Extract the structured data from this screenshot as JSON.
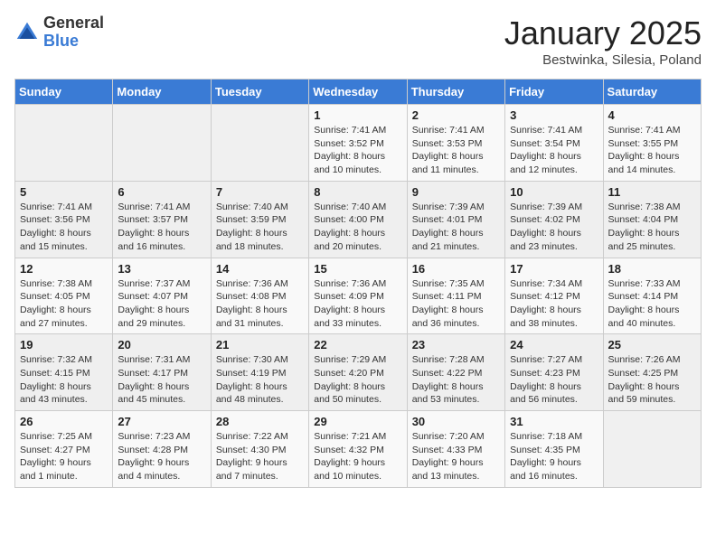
{
  "header": {
    "logo_general": "General",
    "logo_blue": "Blue",
    "month_title": "January 2025",
    "location": "Bestwinka, Silesia, Poland"
  },
  "weekdays": [
    "Sunday",
    "Monday",
    "Tuesday",
    "Wednesday",
    "Thursday",
    "Friday",
    "Saturday"
  ],
  "weeks": [
    [
      {
        "day": "",
        "info": ""
      },
      {
        "day": "",
        "info": ""
      },
      {
        "day": "",
        "info": ""
      },
      {
        "day": "1",
        "info": "Sunrise: 7:41 AM\nSunset: 3:52 PM\nDaylight: 8 hours and 10 minutes."
      },
      {
        "day": "2",
        "info": "Sunrise: 7:41 AM\nSunset: 3:53 PM\nDaylight: 8 hours and 11 minutes."
      },
      {
        "day": "3",
        "info": "Sunrise: 7:41 AM\nSunset: 3:54 PM\nDaylight: 8 hours and 12 minutes."
      },
      {
        "day": "4",
        "info": "Sunrise: 7:41 AM\nSunset: 3:55 PM\nDaylight: 8 hours and 14 minutes."
      }
    ],
    [
      {
        "day": "5",
        "info": "Sunrise: 7:41 AM\nSunset: 3:56 PM\nDaylight: 8 hours and 15 minutes."
      },
      {
        "day": "6",
        "info": "Sunrise: 7:41 AM\nSunset: 3:57 PM\nDaylight: 8 hours and 16 minutes."
      },
      {
        "day": "7",
        "info": "Sunrise: 7:40 AM\nSunset: 3:59 PM\nDaylight: 8 hours and 18 minutes."
      },
      {
        "day": "8",
        "info": "Sunrise: 7:40 AM\nSunset: 4:00 PM\nDaylight: 8 hours and 20 minutes."
      },
      {
        "day": "9",
        "info": "Sunrise: 7:39 AM\nSunset: 4:01 PM\nDaylight: 8 hours and 21 minutes."
      },
      {
        "day": "10",
        "info": "Sunrise: 7:39 AM\nSunset: 4:02 PM\nDaylight: 8 hours and 23 minutes."
      },
      {
        "day": "11",
        "info": "Sunrise: 7:38 AM\nSunset: 4:04 PM\nDaylight: 8 hours and 25 minutes."
      }
    ],
    [
      {
        "day": "12",
        "info": "Sunrise: 7:38 AM\nSunset: 4:05 PM\nDaylight: 8 hours and 27 minutes."
      },
      {
        "day": "13",
        "info": "Sunrise: 7:37 AM\nSunset: 4:07 PM\nDaylight: 8 hours and 29 minutes."
      },
      {
        "day": "14",
        "info": "Sunrise: 7:36 AM\nSunset: 4:08 PM\nDaylight: 8 hours and 31 minutes."
      },
      {
        "day": "15",
        "info": "Sunrise: 7:36 AM\nSunset: 4:09 PM\nDaylight: 8 hours and 33 minutes."
      },
      {
        "day": "16",
        "info": "Sunrise: 7:35 AM\nSunset: 4:11 PM\nDaylight: 8 hours and 36 minutes."
      },
      {
        "day": "17",
        "info": "Sunrise: 7:34 AM\nSunset: 4:12 PM\nDaylight: 8 hours and 38 minutes."
      },
      {
        "day": "18",
        "info": "Sunrise: 7:33 AM\nSunset: 4:14 PM\nDaylight: 8 hours and 40 minutes."
      }
    ],
    [
      {
        "day": "19",
        "info": "Sunrise: 7:32 AM\nSunset: 4:15 PM\nDaylight: 8 hours and 43 minutes."
      },
      {
        "day": "20",
        "info": "Sunrise: 7:31 AM\nSunset: 4:17 PM\nDaylight: 8 hours and 45 minutes."
      },
      {
        "day": "21",
        "info": "Sunrise: 7:30 AM\nSunset: 4:19 PM\nDaylight: 8 hours and 48 minutes."
      },
      {
        "day": "22",
        "info": "Sunrise: 7:29 AM\nSunset: 4:20 PM\nDaylight: 8 hours and 50 minutes."
      },
      {
        "day": "23",
        "info": "Sunrise: 7:28 AM\nSunset: 4:22 PM\nDaylight: 8 hours and 53 minutes."
      },
      {
        "day": "24",
        "info": "Sunrise: 7:27 AM\nSunset: 4:23 PM\nDaylight: 8 hours and 56 minutes."
      },
      {
        "day": "25",
        "info": "Sunrise: 7:26 AM\nSunset: 4:25 PM\nDaylight: 8 hours and 59 minutes."
      }
    ],
    [
      {
        "day": "26",
        "info": "Sunrise: 7:25 AM\nSunset: 4:27 PM\nDaylight: 9 hours and 1 minute."
      },
      {
        "day": "27",
        "info": "Sunrise: 7:23 AM\nSunset: 4:28 PM\nDaylight: 9 hours and 4 minutes."
      },
      {
        "day": "28",
        "info": "Sunrise: 7:22 AM\nSunset: 4:30 PM\nDaylight: 9 hours and 7 minutes."
      },
      {
        "day": "29",
        "info": "Sunrise: 7:21 AM\nSunset: 4:32 PM\nDaylight: 9 hours and 10 minutes."
      },
      {
        "day": "30",
        "info": "Sunrise: 7:20 AM\nSunset: 4:33 PM\nDaylight: 9 hours and 13 minutes."
      },
      {
        "day": "31",
        "info": "Sunrise: 7:18 AM\nSunset: 4:35 PM\nDaylight: 9 hours and 16 minutes."
      },
      {
        "day": "",
        "info": ""
      }
    ]
  ]
}
